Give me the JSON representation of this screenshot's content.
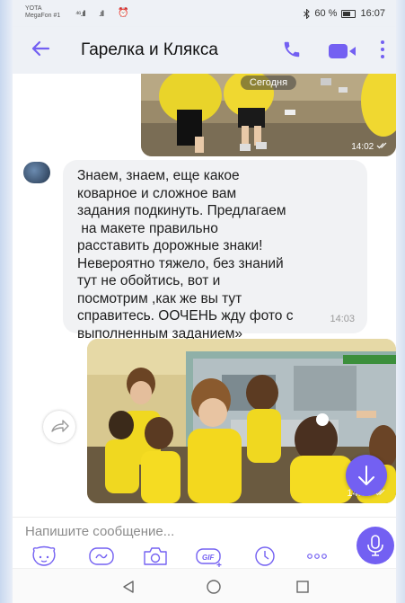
{
  "status_bar": {
    "carrier_name": "YOTA",
    "carrier_sub": "MegaFon #1",
    "signal1": "⁴⁶.ıll",
    "signal2": ".ıll",
    "battery_percent": "60 %",
    "time": "16:07",
    "icons": [
      "bluetooth-icon",
      "battery-icon",
      "alarm-icon"
    ]
  },
  "header": {
    "title": "Гарелка и Клякса",
    "icons": [
      "back-arrow-icon",
      "phone-call-icon",
      "video-call-icon",
      "more-vertical-icon"
    ]
  },
  "chat": {
    "date_separator": "Сегодня",
    "messages": [
      {
        "type": "photo",
        "time": "14:02"
      },
      {
        "type": "text",
        "text": "Знаем, знаем, еще какое\nковарное и сложное вам\nзадания подкинуть. Предлагаем\n на макете правильно\nрасставить дорожные знаки!\nНевероятно тяжело, без знаний\nтут не обойтись, вот и\nпосмотрим ,как же вы тут\nсправитесь. ООЧЕНЬ жду фото с\nвыполненным заданием»",
        "time": "14:03"
      },
      {
        "type": "photo",
        "time": "14:06"
      }
    ],
    "status_icon": "read-checkmarks-icon"
  },
  "compose": {
    "placeholder": "Напишите сообщение...",
    "tools": [
      "sticker-icon",
      "doodle-icon",
      "camera-icon",
      "gif-icon",
      "timer-icon",
      "more-horizontal-icon"
    ],
    "gif_label": "GIF",
    "mic_icon": "microphone-icon"
  },
  "navigation": {
    "buttons": [
      "nav-back-icon",
      "nav-home-icon",
      "nav-recents-icon"
    ]
  },
  "colors": {
    "accent": "#7360f2",
    "bubble": "#f1f2f4",
    "header_bg": "#eef1f6"
  }
}
